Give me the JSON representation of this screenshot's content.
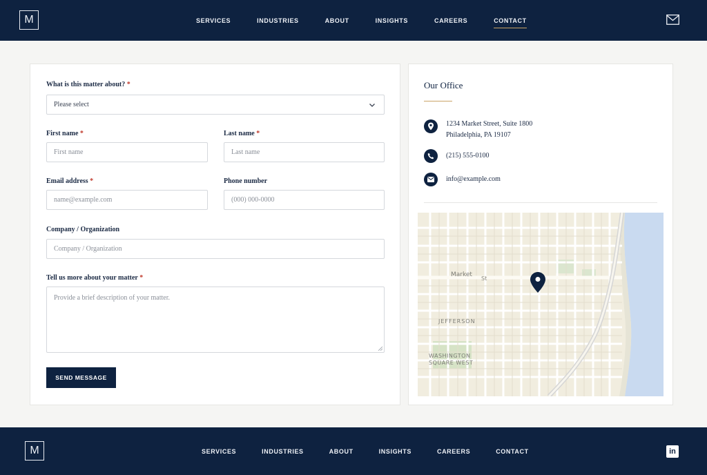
{
  "header": {
    "logo": "M",
    "nav": [
      "SERVICES",
      "INDUSTRIES",
      "ABOUT",
      "INSIGHTS",
      "CAREERS",
      "CONTACT"
    ],
    "active": "CONTACT"
  },
  "form": {
    "matter": {
      "label": "What is this matter about?",
      "required": "*",
      "value": "Please select"
    },
    "first_name": {
      "label": "First name",
      "required": "*",
      "placeholder": "First name"
    },
    "last_name": {
      "label": "Last name",
      "required": "*",
      "placeholder": "Last name"
    },
    "email": {
      "label": "Email address",
      "required": "*",
      "placeholder": "name@example.com"
    },
    "phone": {
      "label": "Phone number",
      "placeholder": "(000) 000-0000"
    },
    "company": {
      "label": "Company / Organization",
      "placeholder": "Company / Organization"
    },
    "details": {
      "label": "Tell us more about your matter",
      "required": "*",
      "placeholder": "Provide a brief description of your matter."
    },
    "submit": "SEND MESSAGE"
  },
  "office": {
    "title": "Our Office",
    "address_line1": "1234 Market Street, Suite 1800",
    "address_line2": "Philadelphia, PA 19107",
    "phone": "(215) 555-0100",
    "email": "info@example.com",
    "map_labels": {
      "market": "Market",
      "street": "St",
      "jefferson": "JEFFERSON",
      "square_line1": "WASHINGTON",
      "square_line2": "SQUARE WEST"
    }
  },
  "footer": {
    "logo": "M",
    "nav": [
      "SERVICES",
      "INDUSTRIES",
      "ABOUT",
      "INSIGHTS",
      "CAREERS",
      "CONTACT"
    ]
  },
  "colors": {
    "navy": "#0e2240",
    "gold": "#c9a466",
    "required": "#c0392b"
  },
  "icons": [
    "mail-icon",
    "chevron-down-icon",
    "location-pin-icon",
    "phone-icon",
    "envelope-icon",
    "map-pin-icon",
    "linkedin-icon"
  ]
}
